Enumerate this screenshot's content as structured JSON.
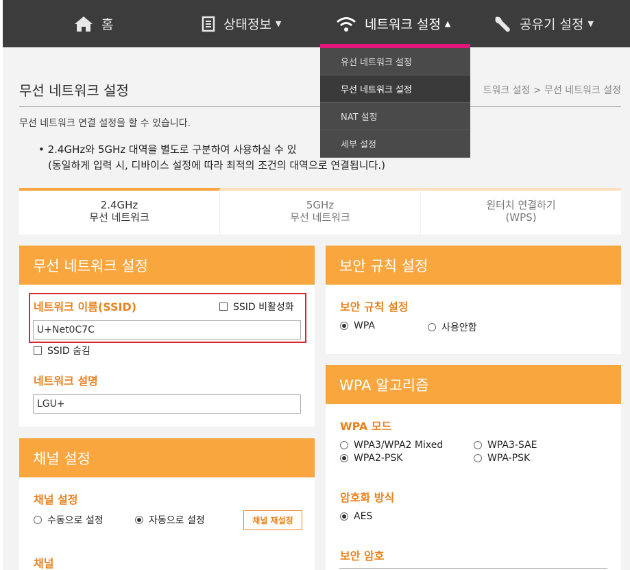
{
  "nav": {
    "home": "홈",
    "status": "상태정보",
    "network": "네트워크 설정",
    "router": "공유기 설정"
  },
  "dropdown": {
    "items": [
      "유선 네트워크 설정",
      "무선 네트워크 설정",
      "NAT 설정",
      "세부 설정"
    ]
  },
  "page": {
    "title": "무선 네트워크 설정",
    "breadcrumb": "트워크 설정 > 무선 네트워크 설정",
    "description": "무선 네트워크 연결 설정을 할 수 있습니다.",
    "note_line1": "• 2.4GHz와 5GHz 대역을 별도로 구분하여 사용하실 수 있",
    "note_line2": "(동일하게 입력 시, 디바이스 설정에 따라 최적의 조건의 대역으로 연결됩니다.)"
  },
  "tabs": [
    {
      "line1": "2.4GHz",
      "line2": "무선 네트워크"
    },
    {
      "line1": "5GHz",
      "line2": "무선 네트워크"
    },
    {
      "line1": "원터치 연결하기",
      "line2": "(WPS)"
    }
  ],
  "wireless": {
    "header": "무선 네트워크 설정",
    "ssid_label": "네트워크 이름(SSID)",
    "ssid_disable": "SSID 비활성화",
    "ssid_value": "U+Net0C7C",
    "ssid_hide": "SSID 숨김",
    "desc_label": "네트워크 설명",
    "desc_value": "LGU+"
  },
  "channel": {
    "header": "채널 설정",
    "label": "채널 설정",
    "manual": "수동으로 설정",
    "auto": "자동으로 설정",
    "reset_btn": "채널 재설정",
    "channel_label": "채널"
  },
  "security": {
    "header": "보안 규칙 설정",
    "label": "보안 규칙 설정",
    "wpa": "WPA",
    "none": "사용안함"
  },
  "wpa_algo": {
    "header": "WPA 알고리즘",
    "mode_label": "WPA 모드",
    "opt1": "WPA3/WPA2 Mixed",
    "opt2": "WPA3-SAE",
    "opt3": "WPA2-PSK",
    "opt4": "WPA-PSK",
    "enc_label": "암호화 방식",
    "enc_aes": "AES",
    "pw_label": "보안 암호"
  },
  "colors": {
    "accent": "#f9a63f",
    "label": "#e8821e",
    "nav_bg": "#3c3c3c",
    "dropdown_top": "#e4157b",
    "highlight": "#d9262e"
  }
}
